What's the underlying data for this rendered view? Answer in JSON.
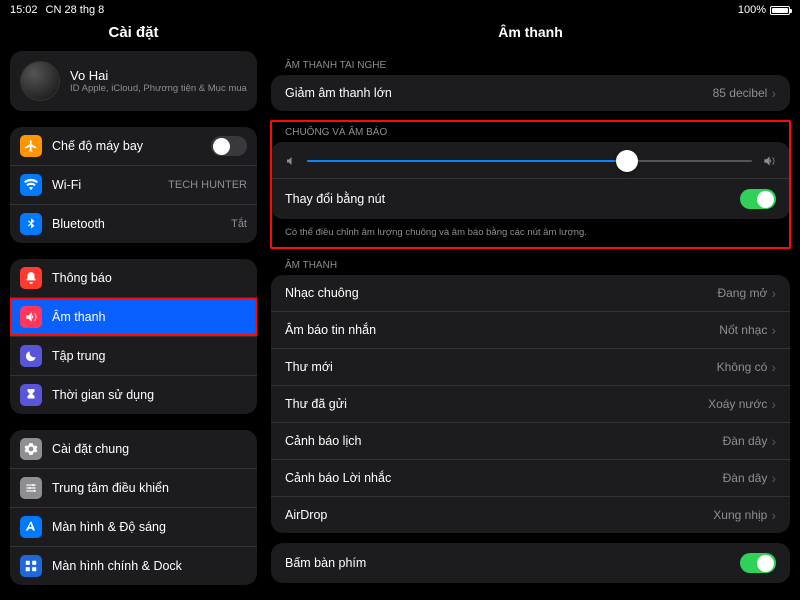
{
  "statusbar": {
    "time": "15:02",
    "date": "CN 28 thg 8",
    "battery_pct": "100%"
  },
  "sidebar": {
    "title": "Cài đặt",
    "profile": {
      "name": "Vo Hai",
      "sub": "ID Apple, iCloud, Phương tiện & Mục mua"
    },
    "group1": {
      "airplane": "Chế độ máy bay",
      "wifi": "Wi-Fi",
      "wifi_detail": "TECH HUNTER",
      "bluetooth": "Bluetooth",
      "bluetooth_detail": "Tắt"
    },
    "group2": {
      "notifications": "Thông báo",
      "sounds": "Âm thanh",
      "focus": "Tập trung",
      "screentime": "Thời gian sử dụng"
    },
    "group3": {
      "general": "Cài đặt chung",
      "control": "Trung tâm điều khiển",
      "display": "Màn hình & Độ sáng",
      "home": "Màn hình chính & Dock"
    }
  },
  "main": {
    "title": "Âm thanh",
    "headphone_header": "ÂM THANH TAI NGHE",
    "reduce_loud": "Giảm âm thanh lớn",
    "reduce_loud_detail": "85 decibel",
    "ringer_header": "CHUÔNG VÀ ÂM BÁO",
    "ringer_slider_pct": 72,
    "change_with_buttons": "Thay đổi bằng nút",
    "ringer_footer": "Có thể điều chỉnh âm lượng chuông và âm báo bằng các nút âm lượng.",
    "sounds_header": "ÂM THANH",
    "ringtone": "Nhạc chuông",
    "ringtone_val": "Đang mở",
    "text": "Âm báo tin nhắn",
    "text_val": "Nốt nhạc",
    "newmail": "Thư mới",
    "newmail_val": "Không có",
    "sentmail": "Thư đã gửi",
    "sentmail_val": "Xoáy nước",
    "calendar": "Cảnh báo lịch",
    "calendar_val": "Đàn dây",
    "reminder": "Cảnh báo Lời nhắc",
    "reminder_val": "Đàn dây",
    "airdrop": "AirDrop",
    "airdrop_val": "Xung nhịp",
    "keyboard": "Bấm bàn phím"
  }
}
